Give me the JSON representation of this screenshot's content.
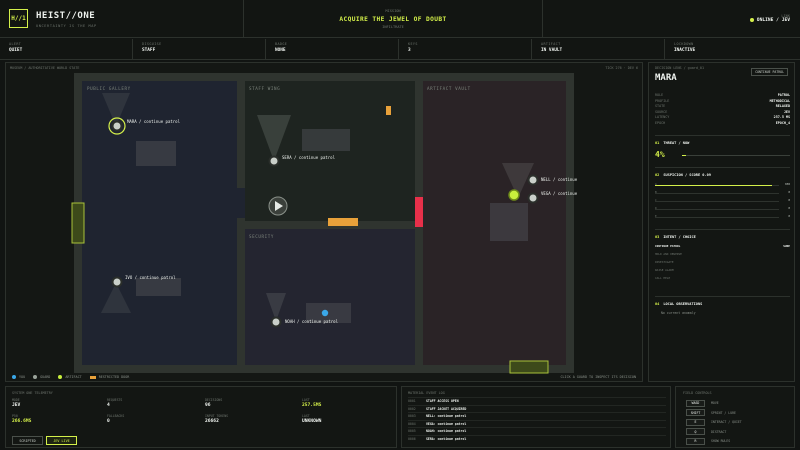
{
  "header": {
    "logo": "H//1",
    "title": "HEIST//ONE",
    "subtitle": "UNCERTAINTY IS THE MAP",
    "mission_kicker": "MISSION",
    "mission_title": "ACQUIRE THE JEWEL OF DOUBT",
    "mission_phase": "INFILTRATE",
    "link_label": "LINK",
    "link_status": "ONLINE / JEV"
  },
  "status": [
    {
      "label": "ALERT",
      "value": "QUIET"
    },
    {
      "label": "DISGUISE",
      "value": "STAFF"
    },
    {
      "label": "BADGE",
      "value": "NONE"
    },
    {
      "label": "KEYS",
      "value": "3"
    },
    {
      "label": "ARTIFACT",
      "value": "IN VAULT"
    },
    {
      "label": "LOCKDOWN",
      "value": "INACTIVE"
    }
  ],
  "map": {
    "title": "MUSEUM / AUTHORITATIVE WORLD STATE",
    "tick": "TICK 276 · DEV 6",
    "rooms": [
      "PUBLIC GALLERY",
      "STAFF WING",
      "ARTIFACT VAULT",
      "SECURITY"
    ],
    "guards": [
      {
        "label": "MARA / continue patrol",
        "selected": true
      },
      {
        "label": "SERA / continue patrol"
      },
      {
        "label": "NELL / continue"
      },
      {
        "label": "VEGA / continue"
      },
      {
        "label": "IVO / continue patrol"
      },
      {
        "label": "NOAH / continue patrol"
      }
    ],
    "legend": [
      "YOU",
      "GUARD",
      "ARTIFACT",
      "RESTRICTED DOOR"
    ],
    "hint": "CLICK A GUARD TO INSPECT ITS DECISION",
    "colors": {
      "you": "#3aa7e8",
      "guard": "#9aa39a",
      "artifact": "#c8ef3c",
      "door": "#e8a13a",
      "alarm": "#e8304a"
    }
  },
  "decision": {
    "kicker": "DECISION LENS / guard_01",
    "name": "MARA",
    "badge": "CONTINUE PATROL",
    "kv": [
      {
        "k": "ROLE",
        "v": "PATROL"
      },
      {
        "k": "PROFILE",
        "v": "METHODICAL"
      },
      {
        "k": "STATE",
        "v": "RELAXED"
      },
      {
        "k": "SOURCE",
        "v": "JEV"
      },
      {
        "k": "LATENCY",
        "v": "257.5 MS"
      },
      {
        "k": "EPOCH",
        "v": "EPOCH_4"
      }
    ],
    "threat_num": "01",
    "threat_title": "THREAT / NOW",
    "threat_value": "4%",
    "threat_fraction": 0.04,
    "suspicion_num": "02",
    "suspicion_title": "SUSPICION / SCORE 0.09",
    "suspicion_bars": [
      {
        "label": "A",
        "value": "938",
        "fraction": 0.94
      },
      {
        "label": "B",
        "value": "0",
        "fraction": 0.0
      },
      {
        "label": "C",
        "value": "0",
        "fraction": 0.0
      },
      {
        "label": "D",
        "value": "0",
        "fraction": 0.0
      },
      {
        "label": "E",
        "value": "0",
        "fraction": 0.0
      }
    ],
    "intent_num": "03",
    "intent_title": "INTENT / CHOICE",
    "intents": [
      {
        "label": "CONTINUE PATROL",
        "value": "SURE",
        "active": true
      },
      {
        "label": "HOLD AND OBSERVE",
        "value": ""
      },
      {
        "label": "INVESTIGATE",
        "value": ""
      },
      {
        "label": "RAISE ALARM",
        "value": ""
      },
      {
        "label": "CALL HELP",
        "value": ""
      }
    ],
    "obs_num": "04",
    "obs_title": "LOCAL OBSERVATIONS",
    "obs_text": "No current anomaly"
  },
  "telemetry": {
    "title": "SYSTEM ONE TELEMETRY",
    "cells": [
      {
        "label": "MODE",
        "value": "JEV"
      },
      {
        "label": "REQUESTS",
        "value": "4"
      },
      {
        "label": "DECISIONS",
        "value": "96"
      },
      {
        "label": "LAST",
        "value": "257.5MS"
      },
      {
        "label": "P50",
        "value": "266.6MS"
      },
      {
        "label": "FALLBACKS",
        "value": "0"
      },
      {
        "label": "INPUT TOKENS",
        "value": "26662"
      },
      {
        "label": "LAST",
        "value": "UNKNOWN"
      }
    ],
    "mode_scripted": "SCRIPTED",
    "mode_live": "JEV LIVE"
  },
  "event_log": {
    "title": "MATERIAL EVENT LOG",
    "events": [
      {
        "id": "0001",
        "text": "STAFF ACCESS OPEN"
      },
      {
        "id": "0002",
        "text": "STAFF JACKET ACQUIRED"
      },
      {
        "id": "0003",
        "text": "NELL: continue patrol"
      },
      {
        "id": "0004",
        "text": "VEGA: continue patrol"
      },
      {
        "id": "0005",
        "text": "NOAH: continue patrol"
      },
      {
        "id": "0006",
        "text": "SERA: continue patrol"
      }
    ]
  },
  "controls": {
    "title": "FIELD CONTROLS",
    "rows": [
      {
        "key": "WASD",
        "label": "MOVE"
      },
      {
        "key": "SHIFT",
        "label": "SPRINT / LURE"
      },
      {
        "key": "E",
        "label": "INTERACT / QUIET"
      },
      {
        "key": "Q",
        "label": "DISTRACT"
      },
      {
        "key": "R",
        "label": "SHOW RULES"
      }
    ]
  }
}
